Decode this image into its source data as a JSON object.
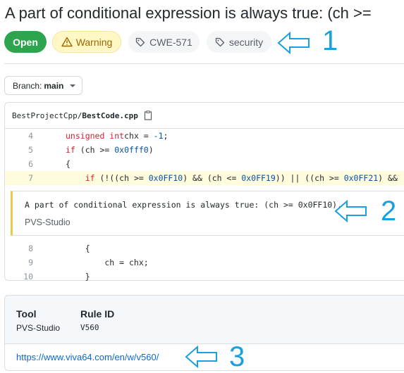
{
  "title": "A part of conditional expression is always true: (ch >=",
  "badges": {
    "status": "Open",
    "severity": "Warning",
    "tags": [
      "CWE-571",
      "security"
    ]
  },
  "branch": {
    "label": "Branch:",
    "value": "main"
  },
  "file": {
    "dir": "BestProjectCpp/",
    "name": "BestCode.cpp"
  },
  "code": {
    "lines_before": [
      {
        "n": "4",
        "code": [
          [
            "kw",
            "unsigned int"
          ],
          [
            "",
            "chx = "
          ],
          [
            "num",
            "-1"
          ],
          [
            "",
            ";"
          ]
        ]
      },
      {
        "n": "5",
        "code": [
          [
            "kw",
            "if"
          ],
          [
            "",
            " (ch >= "
          ],
          [
            "num",
            "0x0fff0"
          ],
          [
            "",
            ")"
          ]
        ]
      },
      {
        "n": "6",
        "code": [
          [
            "",
            "{"
          ]
        ]
      },
      {
        "n": "7",
        "code": [
          [
            "",
            "    "
          ],
          [
            "kw",
            "if"
          ],
          [
            "",
            " (!((ch >= "
          ],
          [
            "num",
            "0x0FF10"
          ],
          [
            "",
            ") && (ch <= "
          ],
          [
            "num",
            "0x0FF19"
          ],
          [
            "",
            ")) || ((ch >= "
          ],
          [
            "num",
            "0x0FF21"
          ],
          [
            "",
            ") && (ch"
          ]
        ]
      }
    ],
    "lines_after": [
      {
        "n": "8",
        "code": [
          [
            "",
            "    {"
          ]
        ]
      },
      {
        "n": "9",
        "code": [
          [
            "",
            "        ch = chx;"
          ]
        ]
      },
      {
        "n": "10",
        "code": [
          [
            "",
            "    }"
          ]
        ]
      }
    ]
  },
  "alert": {
    "message": "A part of conditional expression is always true: (ch >= 0x0FF10).",
    "tool": "PVS-Studio"
  },
  "details": {
    "tool_label": "Tool",
    "tool_value": "PVS-Studio",
    "rule_label": "Rule ID",
    "rule_value": "V560",
    "link": "https://www.viva64.com/en/w/v560/"
  },
  "annotations": [
    "1",
    "2",
    "3"
  ],
  "colors": {
    "open": "#2da44e",
    "warning_bg": "#fff8c5",
    "highlight": "#fffbdd",
    "annotation": "#1a9fe0",
    "link": "#0969da"
  }
}
